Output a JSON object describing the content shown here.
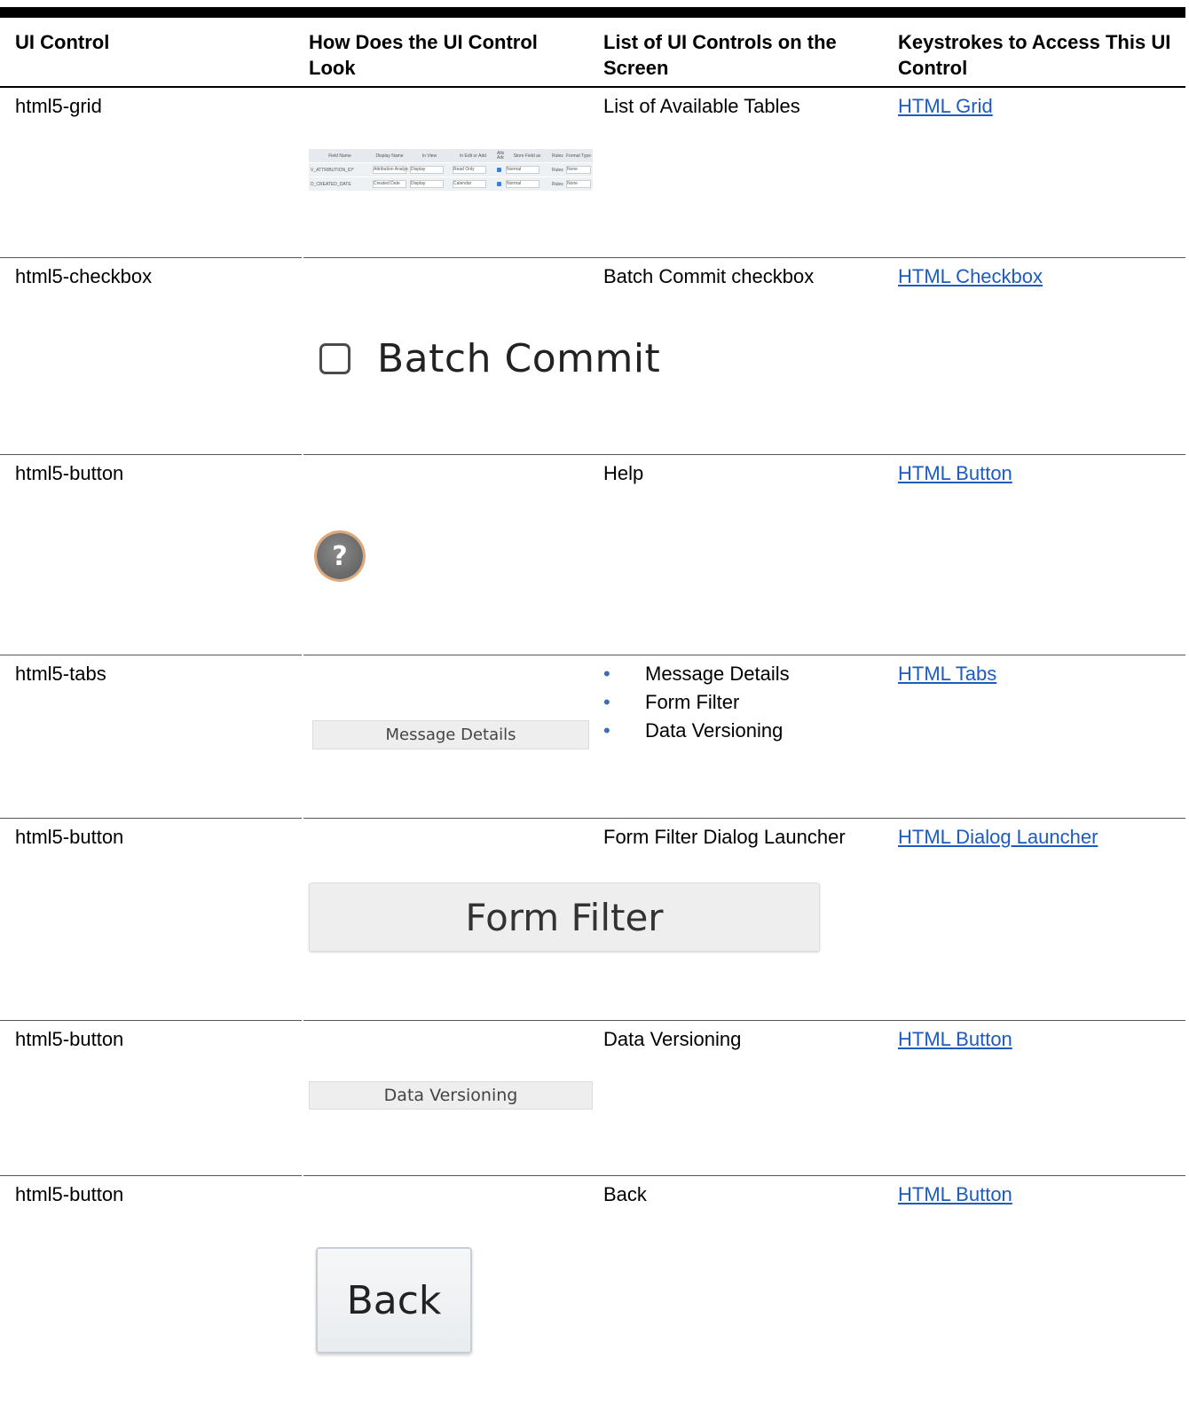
{
  "headers": {
    "col1": "UI Control",
    "col2": "How Does the UI Control Look",
    "col3": "List of UI Controls on the Screen",
    "col4": "Keystrokes to Access This UI Control"
  },
  "rows": [
    {
      "control": "html5-grid",
      "screen": "List of Available Tables",
      "link": "HTML Grid"
    },
    {
      "control": "html5-checkbox",
      "screen": "Batch Commit checkbox",
      "link": "HTML Checkbox"
    },
    {
      "control": "html5-button",
      "screen": "Help",
      "link": "HTML Button"
    },
    {
      "control": "html5-tabs",
      "screen_items": [
        "Message Details",
        "Form Filter",
        "Data Versioning"
      ],
      "link": "HTML Tabs"
    },
    {
      "control": "html5-button",
      "screen": "Form Filter Dialog Launcher",
      "link": "HTML Dialog Launcher"
    },
    {
      "control": "html5-button",
      "screen": "Data Versioning",
      "link": "HTML Button"
    },
    {
      "control": "html5-button",
      "screen": "Back",
      "link": "HTML Button"
    }
  ],
  "images": {
    "grid": {
      "columns": [
        "Field Name",
        "Display Name",
        "In View",
        "In Edit or Add",
        "Allow Add",
        "Store Field as",
        "Rules",
        "Format Type"
      ],
      "rows": [
        [
          "V_ATTRIBUTION_ID*",
          "Attribution Analysis",
          "Display",
          "Read Only",
          "",
          "Normal",
          "Rules",
          "None"
        ],
        [
          "D_CREATED_DATE",
          "Created Date",
          "Display",
          "Calendar",
          "",
          "Normal",
          "Rules",
          "None"
        ]
      ]
    },
    "checkbox_label": "Batch Commit",
    "help_icon": "?",
    "tab_label": "Message Details",
    "form_filter_label": "Form Filter",
    "data_versioning_label": "Data Versioning",
    "back_label": "Back"
  },
  "colors": {
    "link": "#1d5bbf",
    "bullet": "#3a6fb0"
  }
}
